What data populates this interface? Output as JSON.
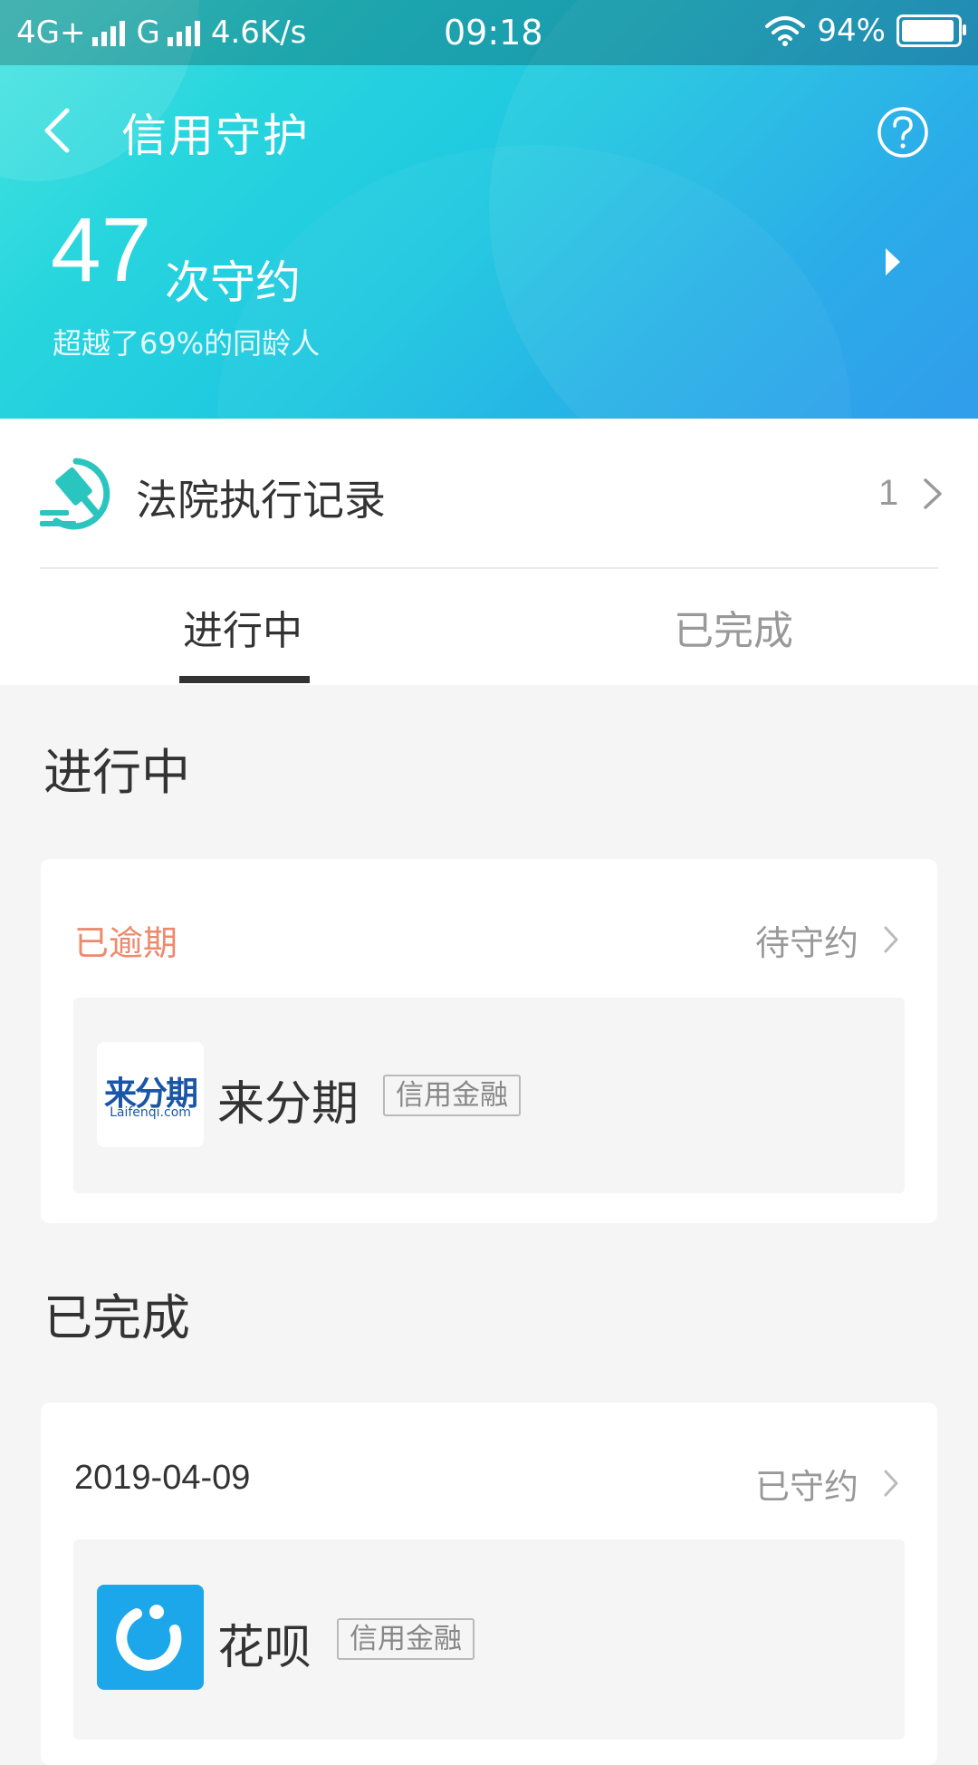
{
  "status": {
    "network1": "4G+",
    "network2": "G",
    "speed": "4.6K/s",
    "time": "09:18",
    "battery": "94%",
    "battery_level": 0.94
  },
  "header": {
    "title": "信用守护",
    "count": "47",
    "count_unit": "次守约",
    "subtext": "超越了69%的同龄人"
  },
  "court_record": {
    "label": "法院执行记录",
    "count": "1"
  },
  "tabs": [
    {
      "label": "进行中",
      "active": true
    },
    {
      "label": "已完成",
      "active": false
    }
  ],
  "sections": {
    "in_progress": {
      "title": "进行中",
      "status": "已逾期",
      "status_color": "#ec8a6e",
      "action": "待守约",
      "merchant": "来分期",
      "tag": "信用金融",
      "logo_text": "来分期",
      "logo_sub": "Laifenqi.com"
    },
    "completed": {
      "title": "已完成",
      "date": "2019-04-09",
      "action": "已守约",
      "merchant": "花呗",
      "tag": "信用金融"
    }
  },
  "colors": {
    "accent": "#27d5de",
    "court_icon": "#2bc5bf",
    "huabei_blue": "#1ba7ea",
    "laifenqi_blue": "#1a56a8"
  },
  "icons": {
    "back": "chevron-left-icon",
    "help": "question-circle-icon",
    "play": "play-triangle-icon",
    "court": "gavel-icon",
    "chevron": "chevron-right-icon"
  }
}
